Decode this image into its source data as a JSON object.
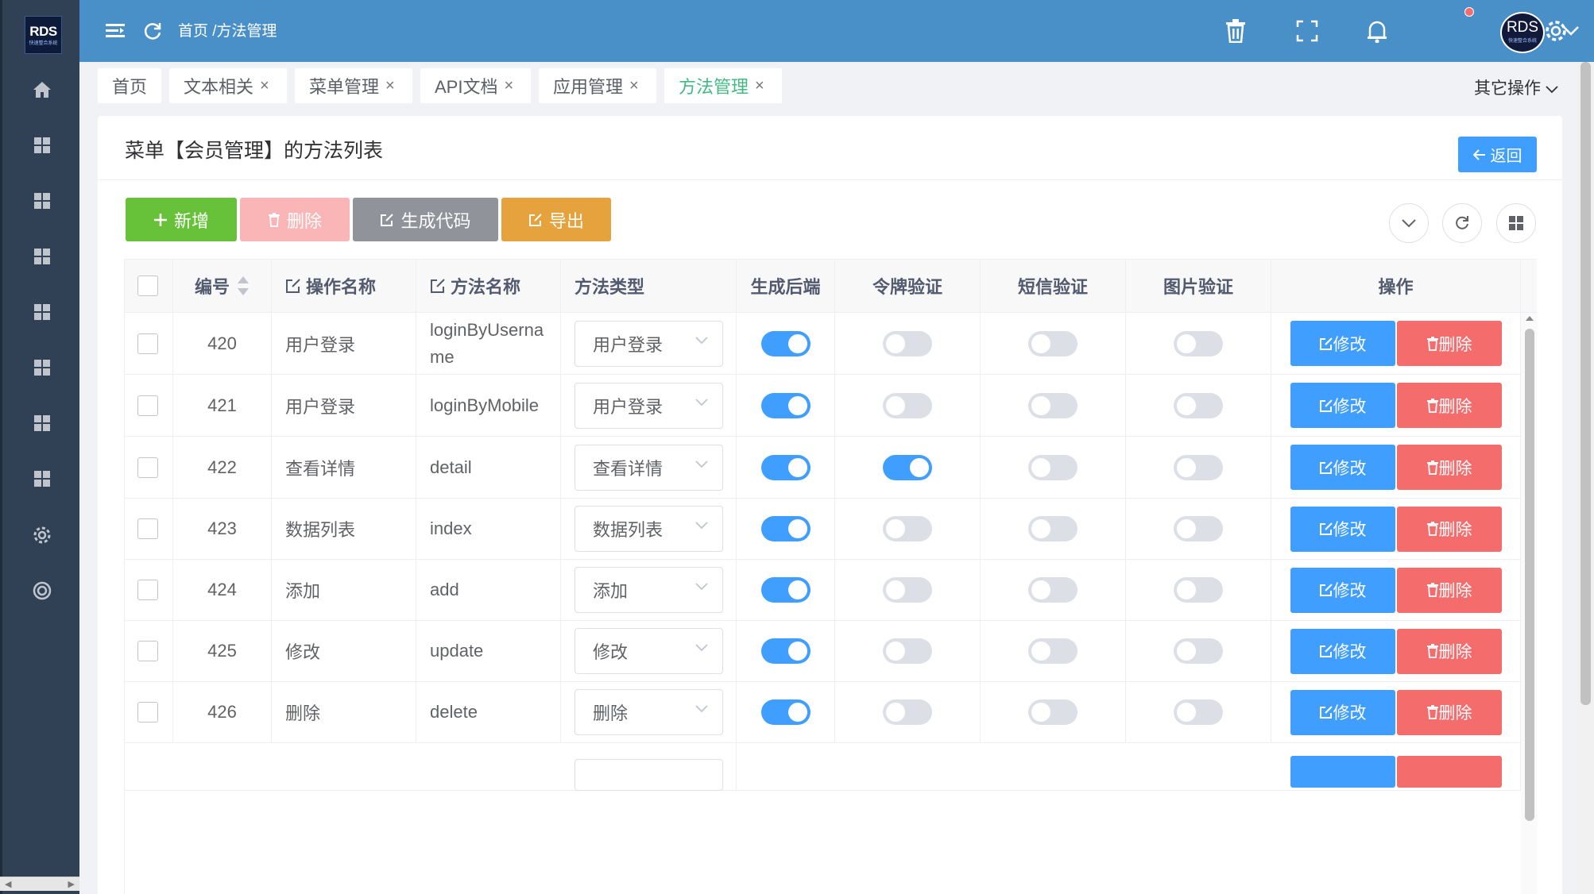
{
  "sidebar": {
    "logo_text": "RDS",
    "logo_sub": "快速整合系统",
    "items": [
      {
        "icon": "home-icon"
      },
      {
        "icon": "grid-icon"
      },
      {
        "icon": "grid-icon"
      },
      {
        "icon": "grid-icon"
      },
      {
        "icon": "grid-icon"
      },
      {
        "icon": "grid-icon"
      },
      {
        "icon": "grid-icon"
      },
      {
        "icon": "grid-icon"
      },
      {
        "icon": "gear-icon"
      },
      {
        "icon": "lifebuoy-icon"
      }
    ]
  },
  "header": {
    "breadcrumb": "首页 /方法管理",
    "avatar_text": "RDS",
    "avatar_sub": "快速整合系统"
  },
  "tabs": [
    {
      "label": "首页",
      "closable": false
    },
    {
      "label": "文本相关",
      "closable": true
    },
    {
      "label": "菜单管理",
      "closable": true
    },
    {
      "label": "API文档",
      "closable": true
    },
    {
      "label": "应用管理",
      "closable": true
    },
    {
      "label": "方法管理",
      "closable": true,
      "active": true
    }
  ],
  "tab_close": "×",
  "other_ops": "其它操作",
  "card": {
    "title": "菜单【会员管理】的方法列表",
    "back_label": "返回"
  },
  "toolbar": {
    "add_label": "新增",
    "delete_label": "删除",
    "generate_label": "生成代码",
    "export_label": "导出"
  },
  "table": {
    "columns": [
      "编号",
      "操作名称",
      "方法名称",
      "方法类型",
      "生成后端",
      "令牌验证",
      "短信验证",
      "图片验证",
      "操作"
    ],
    "edit_label": "修改",
    "delete_label": "删除",
    "rows": [
      {
        "id": "420",
        "op_name": "用户登录",
        "method_name": "loginByUsername",
        "method_name_l1": "loginByUserna",
        "method_name_l2": "me",
        "type": "用户登录",
        "backend": true,
        "token": false,
        "sms": false,
        "image": false
      },
      {
        "id": "421",
        "op_name": "用户登录",
        "method_name": "loginByMobile",
        "type": "用户登录",
        "backend": true,
        "token": false,
        "sms": false,
        "image": false
      },
      {
        "id": "422",
        "op_name": "查看详情",
        "method_name": "detail",
        "type": "查看详情",
        "backend": true,
        "token": true,
        "sms": false,
        "image": false
      },
      {
        "id": "423",
        "op_name": "数据列表",
        "method_name": "index",
        "type": "数据列表",
        "backend": true,
        "token": false,
        "sms": false,
        "image": false
      },
      {
        "id": "424",
        "op_name": "添加",
        "method_name": "add",
        "type": "添加",
        "backend": true,
        "token": false,
        "sms": false,
        "image": false
      },
      {
        "id": "425",
        "op_name": "修改",
        "method_name": "update",
        "type": "修改",
        "backend": true,
        "token": false,
        "sms": false,
        "image": false
      },
      {
        "id": "426",
        "op_name": "删除",
        "method_name": "delete",
        "type": "删除",
        "backend": true,
        "token": false,
        "sms": false,
        "image": false
      }
    ]
  },
  "colors": {
    "sidebar": "#304156",
    "header": "#4a90c8",
    "primary": "#409eff",
    "success": "#67c23a",
    "danger": "#f56c6c",
    "warning": "#e6a23c",
    "info": "#909399",
    "active_tab": "#42b983"
  }
}
